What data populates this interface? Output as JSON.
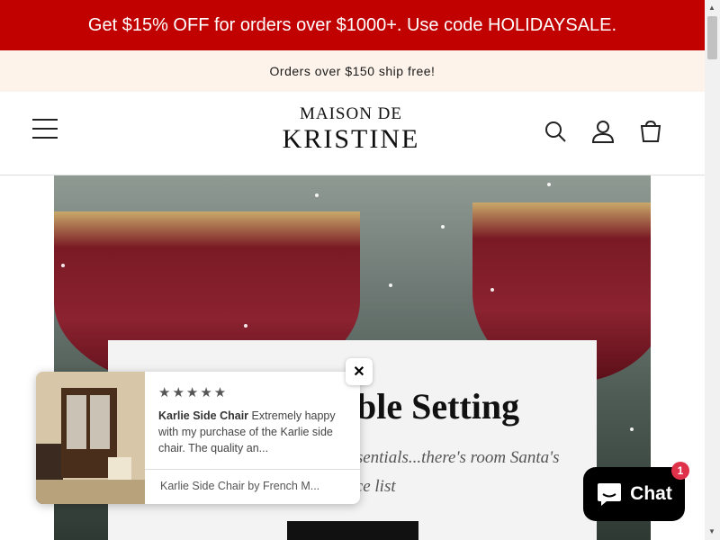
{
  "promo_banner": {
    "text": "Get $15% OFF for orders over $1000+. Use code HOLIDAYSALE."
  },
  "shipping_bar": {
    "text": "Orders over $150 ship free!"
  },
  "header": {
    "logo_line1": "MAISON DE",
    "logo_line2": "KRISTINE",
    "icons": [
      "menu-icon",
      "search-icon",
      "account-icon",
      "cart-icon"
    ]
  },
  "hero": {
    "title": "ble Setting",
    "subtitle": "essentials...there's room Santa's nice list"
  },
  "review_popup": {
    "stars": "★★★★★",
    "product_name": "Karlie Side Chair",
    "review_text": "Extremely happy with my purchase of the Karlie side chair. The quality an...",
    "product_link": "Karlie Side Chair by French M..."
  },
  "close": {
    "label": "✕"
  },
  "chat": {
    "label": "Chat",
    "badge": "1"
  },
  "colors": {
    "promo_bg": "#c10000",
    "ship_bg": "#fdf3ea",
    "chat_bg": "#000000",
    "badge_bg": "#e0314a"
  }
}
